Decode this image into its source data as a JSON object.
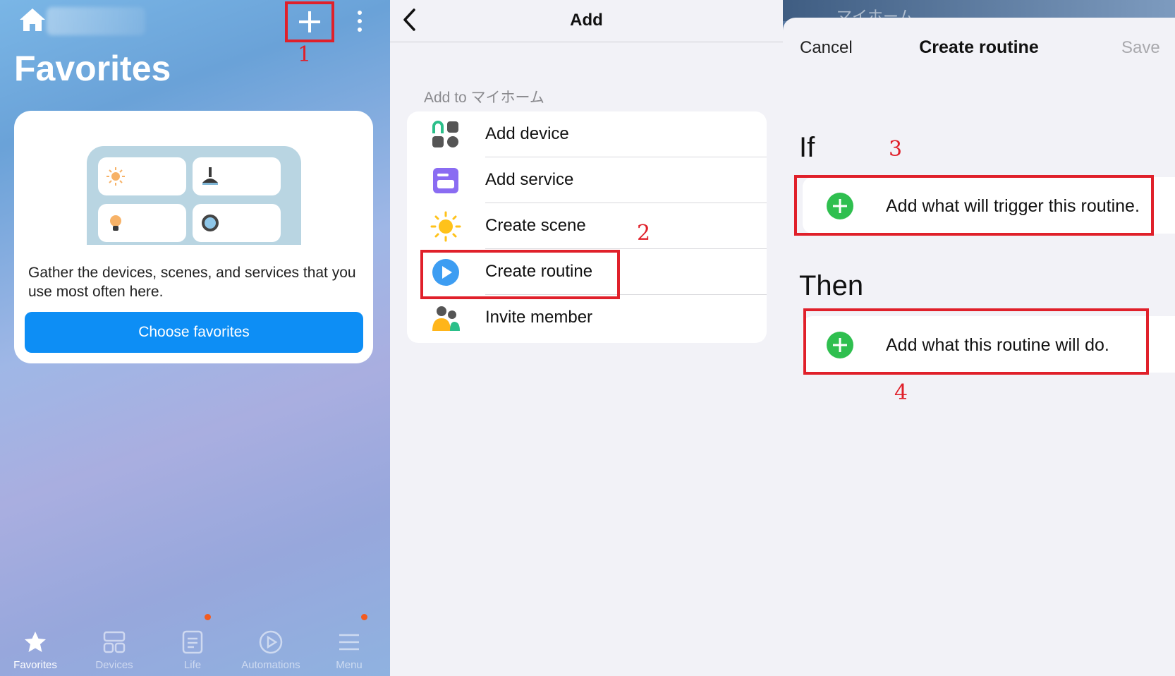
{
  "favorites_screen": {
    "title": "Favorites",
    "empty_message": "Gather the devices, scenes, and services that you use most often here.",
    "choose_button": "Choose favorites",
    "tabs": [
      {
        "label": "Favorites",
        "icon": "star-icon",
        "active": true
      },
      {
        "label": "Devices",
        "icon": "devices-grid-icon",
        "active": false
      },
      {
        "label": "Life",
        "icon": "life-icon",
        "active": false,
        "badge": true
      },
      {
        "label": "Automations",
        "icon": "play-circle-icon",
        "active": false
      },
      {
        "label": "Menu",
        "icon": "menu-icon",
        "active": false,
        "badge": true
      }
    ]
  },
  "add_screen": {
    "title": "Add",
    "section_label": "Add to マイホーム",
    "items": [
      {
        "label": "Add device",
        "icon": "add-device-icon"
      },
      {
        "label": "Add service",
        "icon": "service-icon"
      },
      {
        "label": "Create scene",
        "icon": "sun-icon"
      },
      {
        "label": "Create routine",
        "icon": "routine-play-icon"
      },
      {
        "label": "Invite member",
        "icon": "members-icon"
      }
    ]
  },
  "routine_screen": {
    "cancel": "Cancel",
    "title": "Create routine",
    "save": "Save",
    "if_label": "If",
    "if_action": "Add what will trigger this routine.",
    "then_label": "Then",
    "then_action": "Add what this routine will do."
  },
  "annotations": {
    "step1": "1",
    "step2": "2",
    "step3": "3",
    "step4": "4"
  },
  "colors": {
    "accent_blue": "#0d8ef5",
    "highlight_red": "#e0202a",
    "add_green": "#2fbf4f",
    "badge_orange": "#f35b1f"
  }
}
